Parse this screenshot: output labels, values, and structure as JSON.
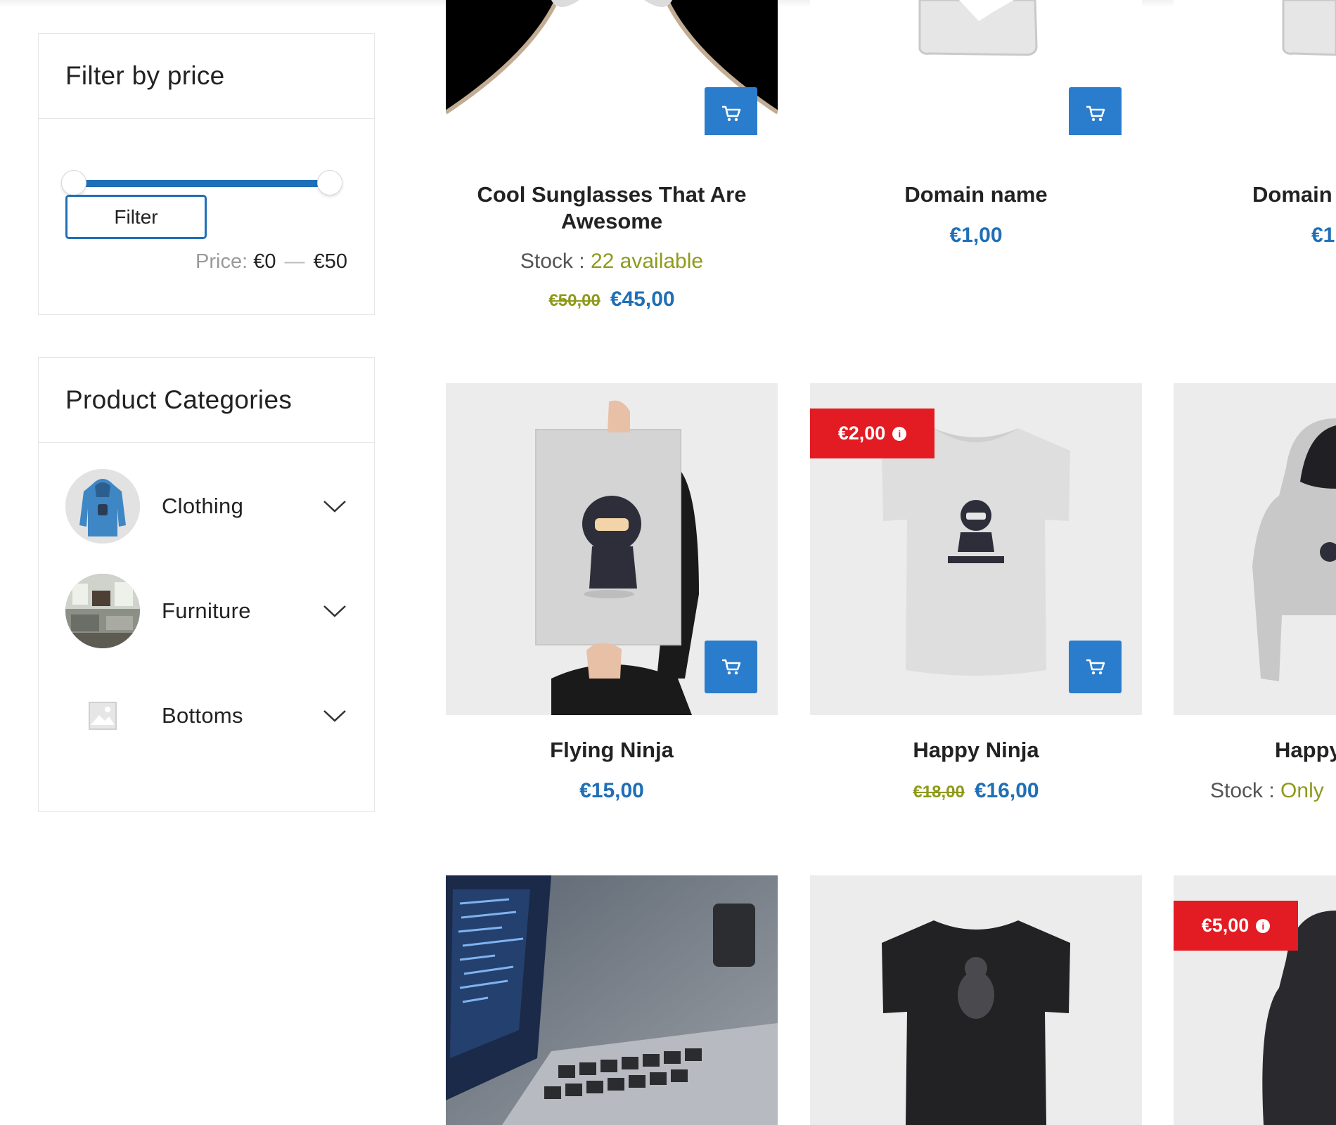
{
  "sidebar": {
    "price_filter": {
      "title": "Filter by price",
      "button_label": "Filter",
      "price_prefix": "Price:",
      "min_label": "€0",
      "max_label": "€50",
      "separator": "—",
      "range_min_fraction": 0,
      "range_max_fraction": 1
    },
    "categories": {
      "title": "Product Categories",
      "items": [
        {
          "label": "Clothing"
        },
        {
          "label": "Furniture"
        },
        {
          "label": "Bottoms"
        }
      ]
    }
  },
  "products": [
    {
      "title": "Cool Sunglasses That Are Awesome",
      "stock_prefix": "Stock :",
      "stock_value": "22 available",
      "old_price": "€50,00",
      "price": "€45,00"
    },
    {
      "title": "Domain name",
      "price": "€1,00"
    },
    {
      "title": "Domain",
      "price": "€1"
    },
    {
      "title": "Flying Ninja",
      "price": "€15,00"
    },
    {
      "title": "Happy Ninja",
      "old_price": "€18,00",
      "price": "€16,00",
      "badge": "€2,00"
    },
    {
      "title": "Happy",
      "stock_prefix": "Stock :",
      "stock_value": "Only"
    },
    {
      "title": ""
    },
    {
      "title": ""
    },
    {
      "badge": "€5,00"
    }
  ],
  "icons": {
    "cart": "cart-icon",
    "chevron": "chevron-down-icon",
    "info": "info-icon",
    "placeholder": "image-placeholder-icon"
  },
  "colors": {
    "accent": "#1f6fb6",
    "cart_button": "#2a7dcc",
    "sale": "#e31b23",
    "stock": "#8e9a1c"
  }
}
